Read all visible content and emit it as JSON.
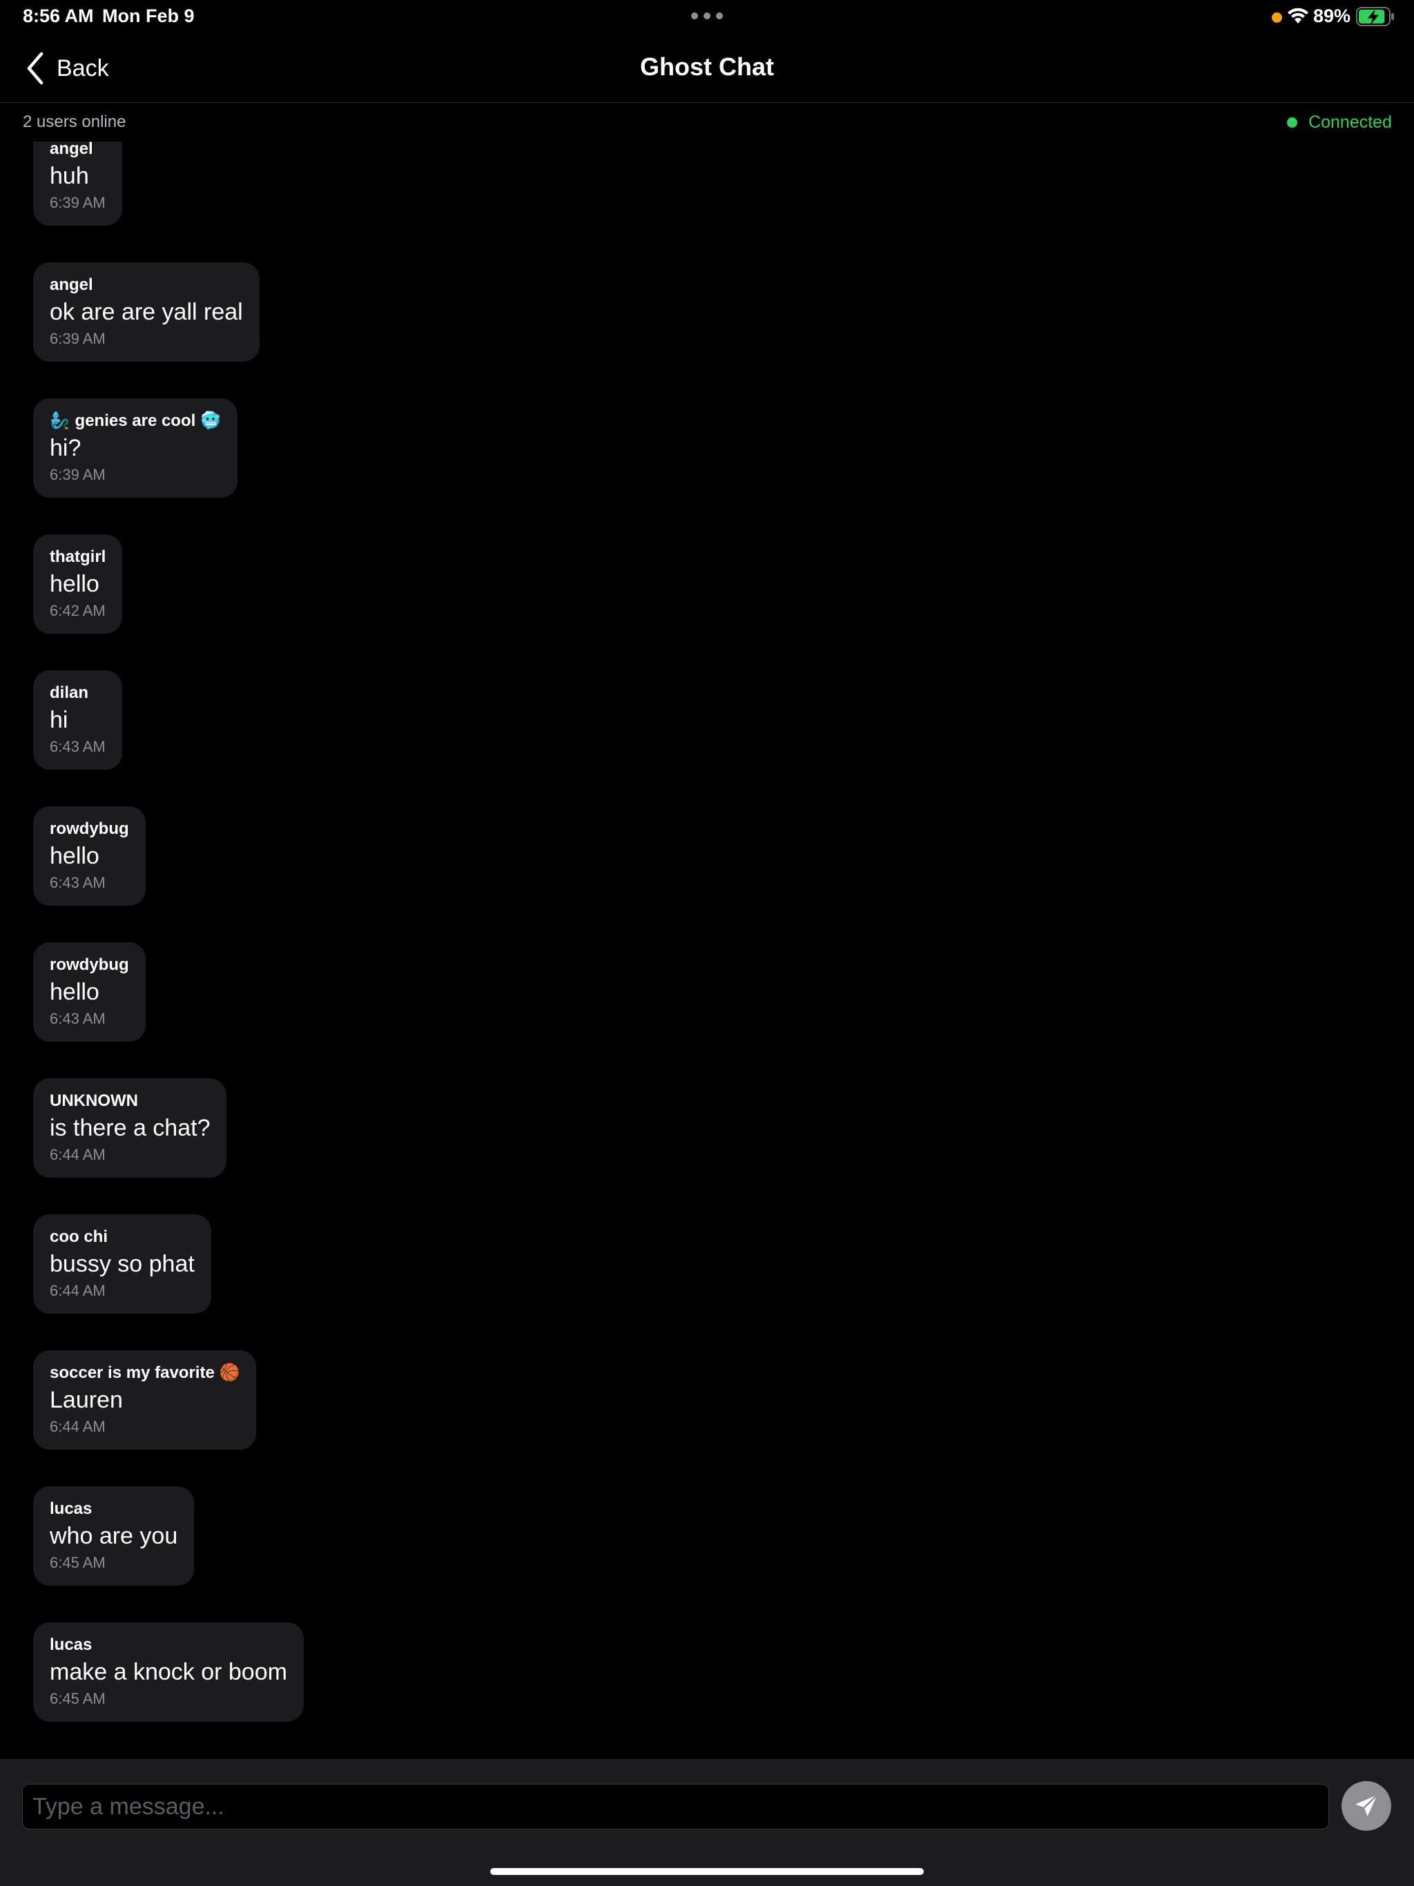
{
  "status_bar": {
    "time": "8:56 AM",
    "date": "Mon Feb 9",
    "battery_percent": "89%",
    "battery_level": 0.89,
    "privacy_indicator_color": "#ff9f0a",
    "battery_color": "#30d158",
    "icons": [
      "multitask-dots-icon",
      "wifi-icon",
      "battery-charging-icon"
    ]
  },
  "nav": {
    "back_label": "Back",
    "title": "Ghost Chat"
  },
  "sub_header": {
    "users_online": "2 users online",
    "connection_status": "Connected",
    "connection_color": "#30d158"
  },
  "messages": [
    {
      "sender": "angel",
      "text": "huh",
      "time": "6:39 AM"
    },
    {
      "sender": "angel",
      "text": "ok are are yall real",
      "time": "6:39 AM"
    },
    {
      "sender": "🧞‍♂️ genies are cool 🥶",
      "text": "hi?",
      "time": "6:39 AM"
    },
    {
      "sender": "thatgirl",
      "text": "hello",
      "time": "6:42 AM"
    },
    {
      "sender": "dilan",
      "text": "hi",
      "time": "6:43 AM"
    },
    {
      "sender": "rowdybug",
      "text": "hello",
      "time": "6:43 AM"
    },
    {
      "sender": "rowdybug",
      "text": "hello",
      "time": "6:43 AM"
    },
    {
      "sender": "UNKNOWN",
      "text": "is there a chat?",
      "time": "6:44 AM"
    },
    {
      "sender": "coo chi",
      "text": "bussy so phat",
      "time": "6:44 AM"
    },
    {
      "sender": "soccer is my favorite 🏀",
      "text": "Lauren",
      "time": "6:44 AM"
    },
    {
      "sender": "lucas",
      "text": "who are you",
      "time": "6:45 AM"
    },
    {
      "sender": "lucas",
      "text": "make a knock or boom",
      "time": "6:45 AM"
    }
  ],
  "composer": {
    "placeholder": "Type a message...",
    "value": "",
    "send_icon": "send-icon"
  }
}
